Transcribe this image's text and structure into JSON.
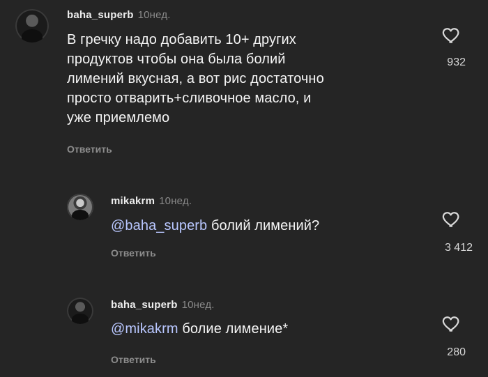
{
  "comments": [
    {
      "username": "baha_superb",
      "time": "10нед.",
      "text_lines": [
        "В гречку надо добавить 10+ других",
        "продуктов чтобы она была болий",
        "лимений вкусная, а вот рис достаточно",
        "просто отварить+сливочное масло, и",
        "уже приемлемо"
      ],
      "reply_label": "Ответить",
      "likes": "932"
    },
    {
      "username": "mikakrm",
      "time": "10нед.",
      "mention": "@baha_superb",
      "text": " болий лимений?",
      "reply_label": "Ответить",
      "likes": "3 412"
    },
    {
      "username": "baha_superb",
      "time": "10нед.",
      "mention": "@mikakrm",
      "text": " болие лимение*",
      "reply_label": "Ответить",
      "likes": "280"
    }
  ]
}
